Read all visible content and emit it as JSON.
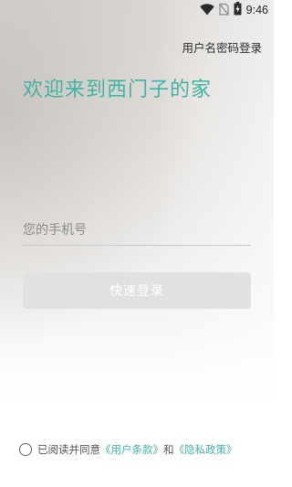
{
  "status_bar": {
    "time": "9:46",
    "icons": [
      "wifi-icon",
      "no-sim-icon",
      "battery-charging-icon"
    ]
  },
  "header": {
    "account_login_link": "用户名密码登录"
  },
  "welcome": {
    "title": "欢迎来到西门子的家"
  },
  "phone_input": {
    "placeholder": "您的手机号",
    "value": ""
  },
  "quick_login_button": {
    "label": "快速登录"
  },
  "agreement": {
    "checked": false,
    "prefix": "已阅读并同意",
    "user_terms_link": "《用户条款》",
    "and_text": "和",
    "privacy_policy_link": "《隐私政策》"
  },
  "colors": {
    "accent": "#43b2a4",
    "button_disabled_bg": "#e2e1e0",
    "button_text": "#ffffff"
  }
}
